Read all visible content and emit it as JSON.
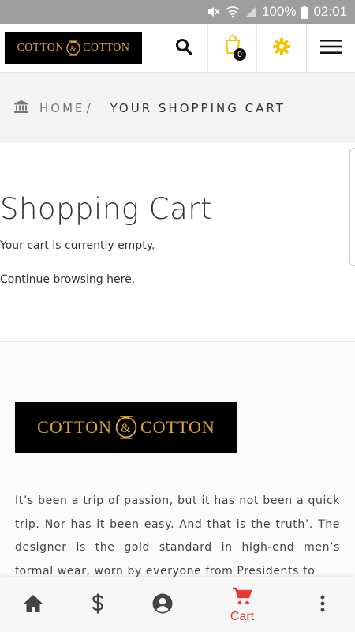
{
  "status_bar": {
    "battery": "100%",
    "time": "02:01"
  },
  "header": {
    "logo": {
      "left": "COTTON",
      "amp": "&",
      "right": "COTTON"
    },
    "cart_count": "0",
    "colors": {
      "gold": "#e0a53a",
      "gear": "#f5c400"
    }
  },
  "breadcrumb": {
    "home": "HOME",
    "separator": "/",
    "current": "YOUR SHOPPING CART"
  },
  "cart": {
    "title": "Shopping Cart",
    "empty_message": "Your cart is currently empty.",
    "continue_text": "Continue browsing here."
  },
  "footer": {
    "logo": {
      "left": "COTTON",
      "amp": "&",
      "right": "COTTON"
    },
    "about": "It’s been a trip of passion, but it has not been a quick trip. Nor has it been easy. And that is the truth’. The designer is the gold standard in high-end men’s formal wear, worn by everyone from Presidents to"
  },
  "bottom_nav": {
    "items": [
      {
        "icon": "home-icon"
      },
      {
        "icon": "dollar-icon"
      },
      {
        "icon": "account-icon"
      },
      {
        "icon": "cart-icon",
        "label": "Cart",
        "active": true
      },
      {
        "icon": "more-vert-icon"
      }
    ],
    "active_color": "#e53935"
  }
}
